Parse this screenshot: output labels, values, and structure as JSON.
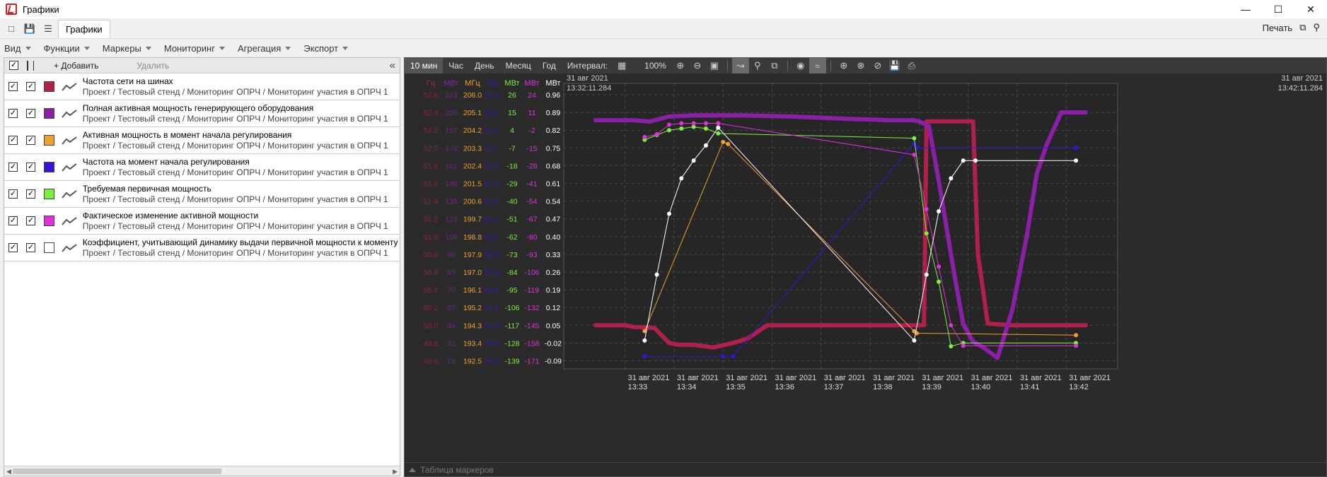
{
  "window": {
    "title": "Графики"
  },
  "tabbar": {
    "active_tab": "Графики",
    "print_label": "Печать"
  },
  "menu": [
    {
      "label": "Вид"
    },
    {
      "label": "Функции"
    },
    {
      "label": "Маркеры"
    },
    {
      "label": "Мониторинг"
    },
    {
      "label": "Агрегация"
    },
    {
      "label": "Экспорт"
    }
  ],
  "left_panel": {
    "add_label": "+ Добавить",
    "delete_label": "Удалить",
    "series": [
      {
        "name": "Частота сети на шинах",
        "path": "Проект / Тестовый стенд / Мониторинг ОПРЧ / Мониторинг участия в ОПРЧ 1",
        "color": "#b0204a",
        "visible": true
      },
      {
        "name": "Полная активная мощность генерирующего оборудования",
        "path": "Проект / Тестовый стенд / Мониторинг ОПРЧ / Мониторинг участия в ОПРЧ 1",
        "color": "#8b1fa8",
        "visible": true
      },
      {
        "name": "Активная мощность в момент начала регулирования",
        "path": "Проект / Тестовый стенд / Мониторинг ОПРЧ / Мониторинг участия в ОПРЧ 1",
        "color": "#f0a030",
        "visible": true
      },
      {
        "name": "Частота на момент начала регулирования",
        "path": "Проект / Тестовый стенд / Мониторинг ОПРЧ / Мониторинг участия в ОПРЧ 1",
        "color": "#3a10e0",
        "visible": true
      },
      {
        "name": "Требуемая первичная мощность",
        "path": "Проект / Тестовый стенд / Мониторинг ОПРЧ / Мониторинг участия в ОПРЧ 1",
        "color": "#7ef040",
        "visible": true
      },
      {
        "name": "Фактическое изменение активной мощности",
        "path": "Проект / Тестовый стенд / Мониторинг ОПРЧ / Мониторинг участия в ОПРЧ 1",
        "color": "#e030e0",
        "visible": true
      },
      {
        "name": "Коэффициент, учитывающий динамику выдачи первичной мощности к моменту",
        "path": "Проект / Тестовый стенд / Мониторинг ОПРЧ / Мониторинг участия в ОПРЧ 1",
        "color": "#ffffff",
        "visible": true
      }
    ]
  },
  "chart_toolbar": {
    "ranges": [
      "10 мин",
      "Час",
      "День",
      "Месяц",
      "Год"
    ],
    "active_range": "10 мин",
    "interval_label": "Интервал:",
    "zoom": "100%"
  },
  "marker_table_label": "Таблица маркеров",
  "chart_data": {
    "type": "line",
    "time_start": "31 авг 2021\n13:32:11.284",
    "time_end": "31 авг 2021\n13:42:11.284",
    "start_date": "31 авг 2021",
    "start_time": "13:32:11.284",
    "end_date": "31 авг 2021",
    "end_time": "13:42:11.284",
    "x_ticks": [
      {
        "date": "31 авг 2021",
        "time": "13:33"
      },
      {
        "date": "31 авг 2021",
        "time": "13:34"
      },
      {
        "date": "31 авг 2021",
        "time": "13:35"
      },
      {
        "date": "31 авг 2021",
        "time": "13:36"
      },
      {
        "date": "31 авг 2021",
        "time": "13:37"
      },
      {
        "date": "31 авг 2021",
        "time": "13:38"
      },
      {
        "date": "31 авг 2021",
        "time": "13:39"
      },
      {
        "date": "31 авг 2021",
        "time": "13:40"
      },
      {
        "date": "31 авг 2021",
        "time": "13:41"
      },
      {
        "date": "31 авг 2021",
        "time": "13:42"
      }
    ],
    "axes": [
      {
        "unit": "Гц",
        "color": "#b0204a",
        "ticks": [
          "52.6",
          "52.4",
          "52.2",
          "52.0",
          "51.8",
          "51.6",
          "51.4",
          "51.2",
          "51.0",
          "50.8",
          "50.6",
          "50.4",
          "50.2",
          "50.0",
          "49.8",
          "49.6"
        ]
      },
      {
        "unit": "МВт",
        "color": "#8b1fa8",
        "ticks": [
          "213",
          "200",
          "187",
          "174",
          "161",
          "148",
          "135",
          "122",
          "109",
          "96",
          "83",
          "70",
          "57",
          "44",
          "31",
          "18"
        ]
      },
      {
        "unit": "МГц",
        "color": "#f0a030",
        "ticks": [
          "206.0",
          "205.1",
          "204.2",
          "203.3",
          "202.4",
          "201.5",
          "200.6",
          "199.7",
          "198.8",
          "197.9",
          "197.0",
          "196.1",
          "195.2",
          "194.3",
          "193.4",
          "192.5"
        ]
      },
      {
        "unit": "Гц",
        "color": "#3a10e0",
        "ticks": [
          "52.6",
          "52.4",
          "52.2",
          "52.0",
          "51.8",
          "51.6",
          "51.4",
          "51.2",
          "51.0",
          "50.8",
          "50.6",
          "50.4",
          "50.2",
          "50.0",
          "49.8",
          "49.6"
        ]
      },
      {
        "unit": "МВт",
        "color": "#7ef040",
        "ticks": [
          "26",
          "15",
          "4",
          "-7",
          "-18",
          "-29",
          "-40",
          "-51",
          "-62",
          "-73",
          "-84",
          "-95",
          "-106",
          "-117",
          "-128",
          "-139"
        ]
      },
      {
        "unit": "МВт",
        "color": "#e030e0",
        "ticks": [
          "24",
          "11",
          "-2",
          "-15",
          "-28",
          "-41",
          "-54",
          "-67",
          "-80",
          "-93",
          "-106",
          "-119",
          "-132",
          "-145",
          "-158",
          "-171"
        ]
      },
      {
        "unit": "МВт",
        "color": "#ffffff",
        "ticks": [
          "0.96",
          "0.89",
          "0.82",
          "0.75",
          "0.68",
          "0.61",
          "0.54",
          "0.47",
          "0.40",
          "0.33",
          "0.26",
          "0.19",
          "0.12",
          "0.05",
          "-0.02",
          "-0.09"
        ]
      }
    ],
    "series": [
      {
        "name": "Частота сети на шинах",
        "axis": 0,
        "color": "#b0204a",
        "width": 6,
        "markers": false,
        "t": [
          0,
          0.6,
          0.8,
          1.2,
          1.5,
          1.7,
          2.0,
          2.4,
          2.8,
          3.1,
          3.5,
          4.5,
          5.5,
          6.5,
          6.7,
          6.75,
          7.0,
          7.2,
          7.5,
          7.7,
          7.8,
          8.0,
          8.5,
          9.0,
          9.5,
          10.0
        ],
        "v": [
          50.0,
          50.0,
          49.98,
          49.97,
          49.8,
          49.78,
          49.78,
          49.75,
          49.8,
          49.85,
          50.0,
          50.0,
          50.0,
          50.0,
          50.0,
          52.3,
          52.3,
          52.3,
          52.3,
          52.3,
          50.8,
          50.02,
          50.0,
          50.0,
          50.0,
          50.0
        ]
      },
      {
        "name": "Полная активная мощность генерирующего оборудования",
        "axis": 1,
        "color": "#8b1fa8",
        "width": 6,
        "markers": false,
        "t": [
          0,
          0.8,
          1.1,
          1.5,
          2.0,
          2.5,
          3.0,
          4.0,
          5.0,
          6.0,
          6.5,
          6.6,
          6.8,
          7.0,
          7.3,
          7.5,
          7.7,
          7.9,
          8.2,
          8.5,
          8.8,
          9.0,
          9.2,
          9.5,
          10.0
        ],
        "v": [
          194.3,
          194.3,
          193.3,
          197,
          197.8,
          197.9,
          197.9,
          197.0,
          195.5,
          194.3,
          194.3,
          193.5,
          190,
          150,
          85,
          45,
          32,
          28,
          20,
          55,
          110,
          155,
          176,
          200,
          200
        ]
      },
      {
        "name": "Активная мощность в момент начала регулирования",
        "axis": 2,
        "color": "#f0a030",
        "width": 1,
        "markers": true,
        "t": [
          1.0,
          2.6,
          2.7,
          6.5,
          6.55,
          9.8
        ],
        "v": [
          194.0,
          203.6,
          203.5,
          194.0,
          193.9,
          193.8
        ]
      },
      {
        "name": "Частота на момент начала регулирования",
        "axis": 3,
        "color": "#3a10e0",
        "width": 1,
        "markers": true,
        "t": [
          1.0,
          2.6,
          2.8,
          6.5,
          6.55,
          9.8
        ],
        "v": [
          49.65,
          49.65,
          49.65,
          52.05,
          52.0,
          52.0
        ]
      },
      {
        "name": "Требуемая первичная мощность",
        "axis": 4,
        "color": "#7ef040",
        "width": 1,
        "markers": true,
        "t": [
          1.0,
          1.25,
          1.5,
          1.75,
          2.0,
          2.25,
          2.5,
          6.5,
          6.75,
          7.0,
          7.25,
          7.5,
          9.8
        ],
        "v": [
          -2,
          1,
          4,
          5,
          6,
          5,
          2,
          -1,
          -60,
          -90,
          -130,
          -128,
          -128
        ]
      },
      {
        "name": "Фактическое изменение активной мощности",
        "axis": 5,
        "color": "#e030e0",
        "width": 1,
        "markers": true,
        "t": [
          1.0,
          1.25,
          1.5,
          1.75,
          2.0,
          2.25,
          2.5,
          6.5,
          6.75,
          7.0,
          7.25,
          7.5,
          9.8
        ],
        "v": [
          -7,
          -5,
          2,
          3,
          3,
          3,
          3,
          -20,
          -60,
          -102,
          -145,
          -160,
          -160
        ]
      },
      {
        "name": "Коэффициент, учитывающий динамику выдачи первичной мощности к моменту",
        "axis": 6,
        "color": "#ffffff",
        "width": 1,
        "markers": true,
        "t": [
          1.0,
          1.25,
          1.5,
          1.75,
          2.0,
          2.25,
          2.5,
          6.5,
          6.75,
          7.0,
          7.25,
          7.5,
          7.75,
          9.8
        ],
        "v": [
          -0.01,
          0.25,
          0.49,
          0.63,
          0.7,
          0.76,
          0.83,
          -0.01,
          0.25,
          0.5,
          0.63,
          0.7,
          0.7,
          0.7
        ]
      }
    ]
  }
}
